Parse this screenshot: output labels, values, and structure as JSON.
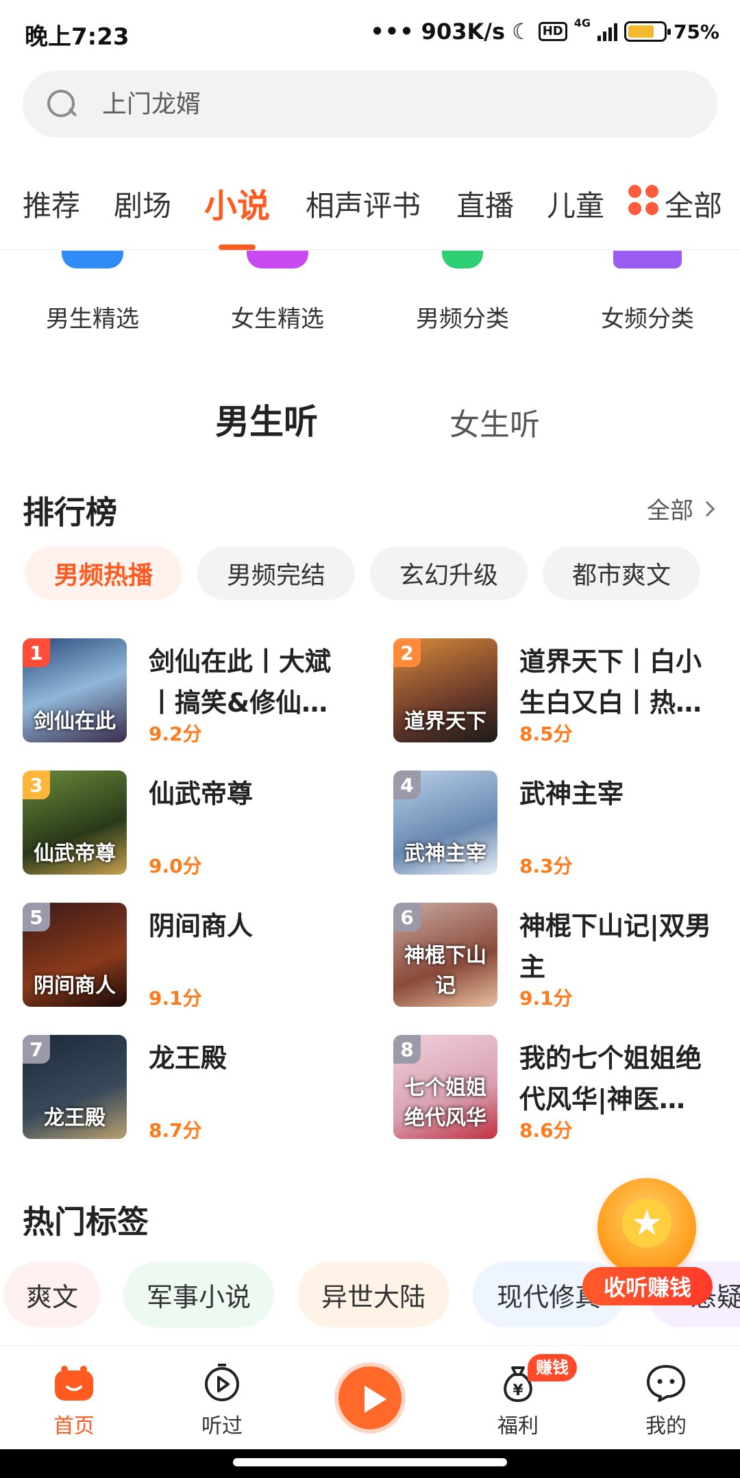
{
  "status": {
    "time": "晚上7:23",
    "speed": "903K/s",
    "hd": "HD",
    "net": "4G",
    "battery": "75%",
    "battery_level": 0.75
  },
  "search": {
    "placeholder": "上门龙婿"
  },
  "category_tabs": [
    {
      "label": "推荐"
    },
    {
      "label": "剧场"
    },
    {
      "label": "小说",
      "active": true
    },
    {
      "label": "相声评书"
    },
    {
      "label": "直播"
    },
    {
      "label": "儿童"
    },
    {
      "label": "全部"
    }
  ],
  "icon_row": [
    {
      "label": "男生精选",
      "color": "#2f8cf4"
    },
    {
      "label": "女生精选",
      "color": "#c94af0"
    },
    {
      "label": "男频分类",
      "color": "#2ecf74"
    },
    {
      "label": "女频分类",
      "color": "#9a5cf2"
    }
  ],
  "gender_tabs": [
    {
      "label": "男生听",
      "active": true
    },
    {
      "label": "女生听"
    }
  ],
  "ranking": {
    "title": "排行榜",
    "all_label": "全部",
    "chips": [
      {
        "label": "男频热播",
        "active": true
      },
      {
        "label": "男频完结"
      },
      {
        "label": "玄幻升级"
      },
      {
        "label": "都市爽文"
      }
    ],
    "books": [
      {
        "rank": "1",
        "title": "剑仙在此丨大斌丨搞笑&修仙…",
        "score": "9.2分",
        "cover_text": "剑仙在此",
        "rank_color": "#ff4d3a",
        "cover_bg": "linear-gradient(160deg,#2a4a7a,#8fb6d8 50%,#3a2a4a)"
      },
      {
        "rank": "2",
        "title": "道界天下丨白小生白又白丨热…",
        "score": "8.5分",
        "cover_text": "道界天下",
        "rank_color": "#ff8a3a",
        "cover_bg": "linear-gradient(160deg,#d88a3a,#6a3a2a 60%,#1a1a1a)"
      },
      {
        "rank": "3",
        "title": "仙武帝尊",
        "score": "9.0分",
        "cover_text": "仙武帝尊",
        "rank_color": "#ffb43a",
        "cover_bg": "linear-gradient(160deg,#6a8a3a,#2a3a1a 60%,#c8a050)"
      },
      {
        "rank": "4",
        "title": "武神主宰",
        "score": "8.3分",
        "cover_text": "武神主宰",
        "rank_color": "#9a9aaa",
        "cover_bg": "linear-gradient(160deg,#b8d0e8,#6a88b0 60%,#e8f0f8)"
      },
      {
        "rank": "5",
        "title": "阴间商人",
        "score": "9.1分",
        "cover_text": "阴间商人",
        "rank_color": "#9a9aaa",
        "cover_bg": "linear-gradient(160deg,#3a1a1a,#8a3a1a 60%,#1a0a0a)"
      },
      {
        "rank": "6",
        "title": "神棍下山记|双男主",
        "score": "9.1分",
        "cover_text": "神棍下山记",
        "rank_color": "#9a9aaa",
        "cover_bg": "linear-gradient(160deg,#c8a8a0,#8a4a3a 60%,#e8c0a0)"
      },
      {
        "rank": "7",
        "title": "龙王殿",
        "score": "8.7分",
        "cover_text": "龙王殿",
        "rank_color": "#9a9aaa",
        "cover_bg": "linear-gradient(160deg,#1a2a3a,#3a4a5a 60%,#b8a070)"
      },
      {
        "rank": "8",
        "title": "我的七个姐姐绝代风华|神医…",
        "score": "8.6分",
        "cover_text": "七个姐姐 绝代风华",
        "rank_color": "#9a9aaa",
        "cover_bg": "linear-gradient(160deg,#f0d0d8,#d8a0b0 60%,#c03040)"
      }
    ]
  },
  "hot_tags": {
    "title": "热门标签",
    "tags": [
      {
        "label": "爽文",
        "bg": "#fff1f0"
      },
      {
        "label": "军事小说",
        "bg": "#eef9f1"
      },
      {
        "label": "异世大陆",
        "bg": "#fff3e8"
      },
      {
        "label": "现代修真",
        "bg": "#eef5ff"
      },
      {
        "label": "悬疑",
        "bg": "#f5efff"
      }
    ]
  },
  "earn_float": {
    "label": "收听赚钱"
  },
  "bottom_nav": [
    {
      "label": "首页",
      "icon": "home-icon",
      "active": true
    },
    {
      "label": "听过",
      "icon": "history-icon"
    },
    {
      "label": "",
      "icon": "play-icon"
    },
    {
      "label": "福利",
      "icon": "money-bag-icon",
      "badge": "赚钱"
    },
    {
      "label": "我的",
      "icon": "profile-icon"
    }
  ],
  "colors": {
    "accent": "#ff5a1f",
    "score": "#ff7a1a"
  }
}
